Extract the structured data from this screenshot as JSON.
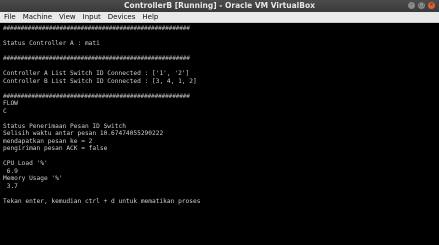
{
  "window": {
    "title": "ControllerB [Running] - Oracle VM VirtualBox",
    "controls": [
      "minimize-icon",
      "maximize-icon",
      "close-icon"
    ]
  },
  "menu": [
    "File",
    "Machine",
    "View",
    "Input",
    "Devices",
    "Help"
  ],
  "console": {
    "lines": [
      "#####################################################",
      "",
      "Status Controller A : mati",
      "",
      "#####################################################",
      "",
      "Controller A List Switch ID Connected : ['1', '2']",
      "Controller B List Switch ID Connected : [3, 4, 1, 2]",
      "",
      "#####################################################",
      "FLOW",
      "C",
      "",
      "Status Penerimaan Pesan ID Switch",
      "Selisih waktu antar pesan 10.67474055290222",
      "mendapatkan pesan ke = 2",
      "pengiriman pesan ACK = false",
      "",
      "CPU Load '%'",
      " 6.9",
      "Memory Usage '%'",
      " 3.7",
      "",
      "Tekan enter, kemudian ctrl + d untuk mematikan proses"
    ]
  }
}
